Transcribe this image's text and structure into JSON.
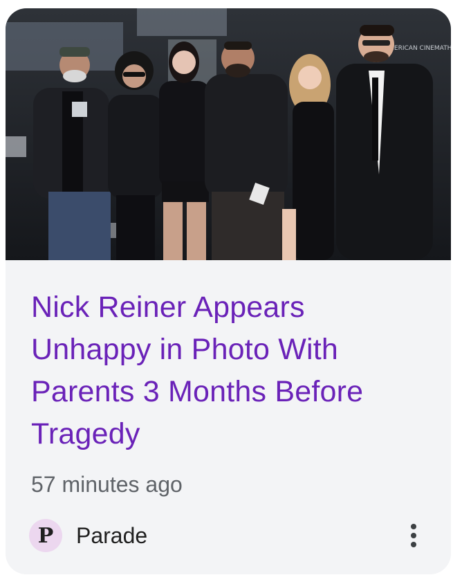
{
  "card": {
    "image_alt": "Group photo of six people at a red-carpet event",
    "backdrop_text": "AMERICAN CINEMATHEQUE",
    "headline": "Nick Reiner Appears Unhappy in Photo With Parents 3 Months Before Tragedy",
    "timestamp": "57 minutes ago",
    "source": {
      "logo_letter": "P",
      "name": "Parade"
    },
    "more_icon": "more-vert-icon"
  },
  "colors": {
    "card_bg": "#f3f4f6",
    "headline": "#6a22b8",
    "meta_text": "#5f6368",
    "logo_bg": "#ecd7ef"
  }
}
